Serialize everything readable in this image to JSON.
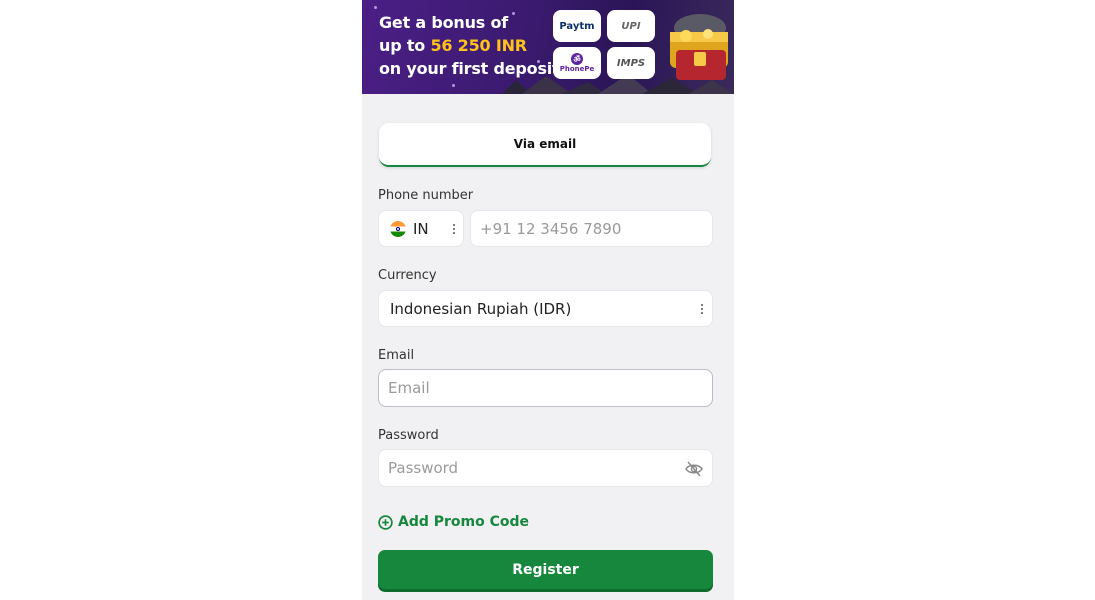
{
  "banner": {
    "line1": "Get a bonus of",
    "line2_prefix": "up to ",
    "amount": "56 250 INR",
    "line3": "on your first deposit",
    "payment_methods": [
      "Paytm",
      "UPI",
      "PhonePe",
      "IMPS"
    ]
  },
  "tabs": {
    "active_label": "Via email"
  },
  "form": {
    "phone": {
      "label": "Phone number",
      "country_code": "IN",
      "placeholder": "+91 12 3456 7890"
    },
    "currency": {
      "label": "Currency",
      "selected": "Indonesian Rupiah (IDR)"
    },
    "email": {
      "label": "Email",
      "placeholder": "Email"
    },
    "password": {
      "label": "Password",
      "placeholder": "Password"
    },
    "promo_label": "Add Promo Code",
    "submit_label": "Register"
  },
  "colors": {
    "brand_green": "#16873c",
    "bonus_gold": "#ffc21a",
    "banner_purple": "#3a1a6e"
  },
  "icons": [
    "india-flag-icon",
    "kebab-menu-icon",
    "eye-slash-icon",
    "plus-circle-icon",
    "treasure-chest-icon"
  ]
}
